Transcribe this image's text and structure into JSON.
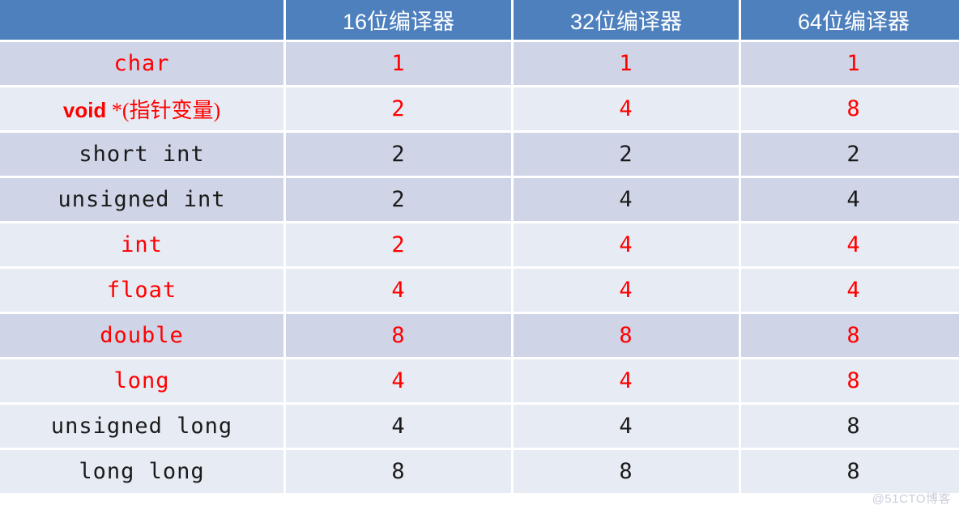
{
  "table": {
    "headers": [
      "",
      "16位编译器",
      "32位编译器",
      "64位编译器"
    ],
    "rows": [
      {
        "type": "char",
        "type_color": "red",
        "type_style": "mono",
        "values": [
          "1",
          "1",
          "1"
        ],
        "value_color": "red",
        "band": "dark"
      },
      {
        "type": "void *(指针变量)",
        "type_color": "red",
        "type_style": "mixed",
        "values": [
          "2",
          "4",
          "8"
        ],
        "value_color": "red",
        "band": "light",
        "kw": "void",
        "rest": " *(指针变量)"
      },
      {
        "type": "short int",
        "type_color": "black",
        "type_style": "mono",
        "values": [
          "2",
          "2",
          "2"
        ],
        "value_color": "black",
        "band": "dark"
      },
      {
        "type": "unsigned int",
        "type_color": "black",
        "type_style": "mono",
        "values": [
          "2",
          "4",
          "4"
        ],
        "value_color": "black",
        "band": "dark"
      },
      {
        "type": "int",
        "type_color": "red",
        "type_style": "mono",
        "values": [
          "2",
          "4",
          "4"
        ],
        "value_color": "red",
        "band": "light"
      },
      {
        "type": "float",
        "type_color": "red",
        "type_style": "mono",
        "values": [
          "4",
          "4",
          "4"
        ],
        "value_color": "red",
        "band": "light"
      },
      {
        "type": "double",
        "type_color": "red",
        "type_style": "mono",
        "values": [
          "8",
          "8",
          "8"
        ],
        "value_color": "red",
        "band": "dark"
      },
      {
        "type": "long",
        "type_color": "red",
        "type_style": "mono",
        "values": [
          "4",
          "4",
          "8"
        ],
        "value_color": "red",
        "band": "light"
      },
      {
        "type": "unsigned long",
        "type_color": "black",
        "type_style": "mono",
        "values": [
          "4",
          "4",
          "8"
        ],
        "value_color": "black",
        "band": "light"
      },
      {
        "type": "long long",
        "type_color": "black",
        "type_style": "mono",
        "values": [
          "8",
          "8",
          "8"
        ],
        "value_color": "black",
        "band": "light"
      }
    ]
  },
  "watermark": {
    "text": "@51CTO博客"
  },
  "colors": {
    "header_bg": "#4E80BE",
    "header_text": "#FFFFFF",
    "band_dark": "#CFD5E7",
    "band_light": "#E7EBF3",
    "text_black": "#1A1A1A",
    "text_red": "#FF0000",
    "watermark": "#C9CED9"
  }
}
